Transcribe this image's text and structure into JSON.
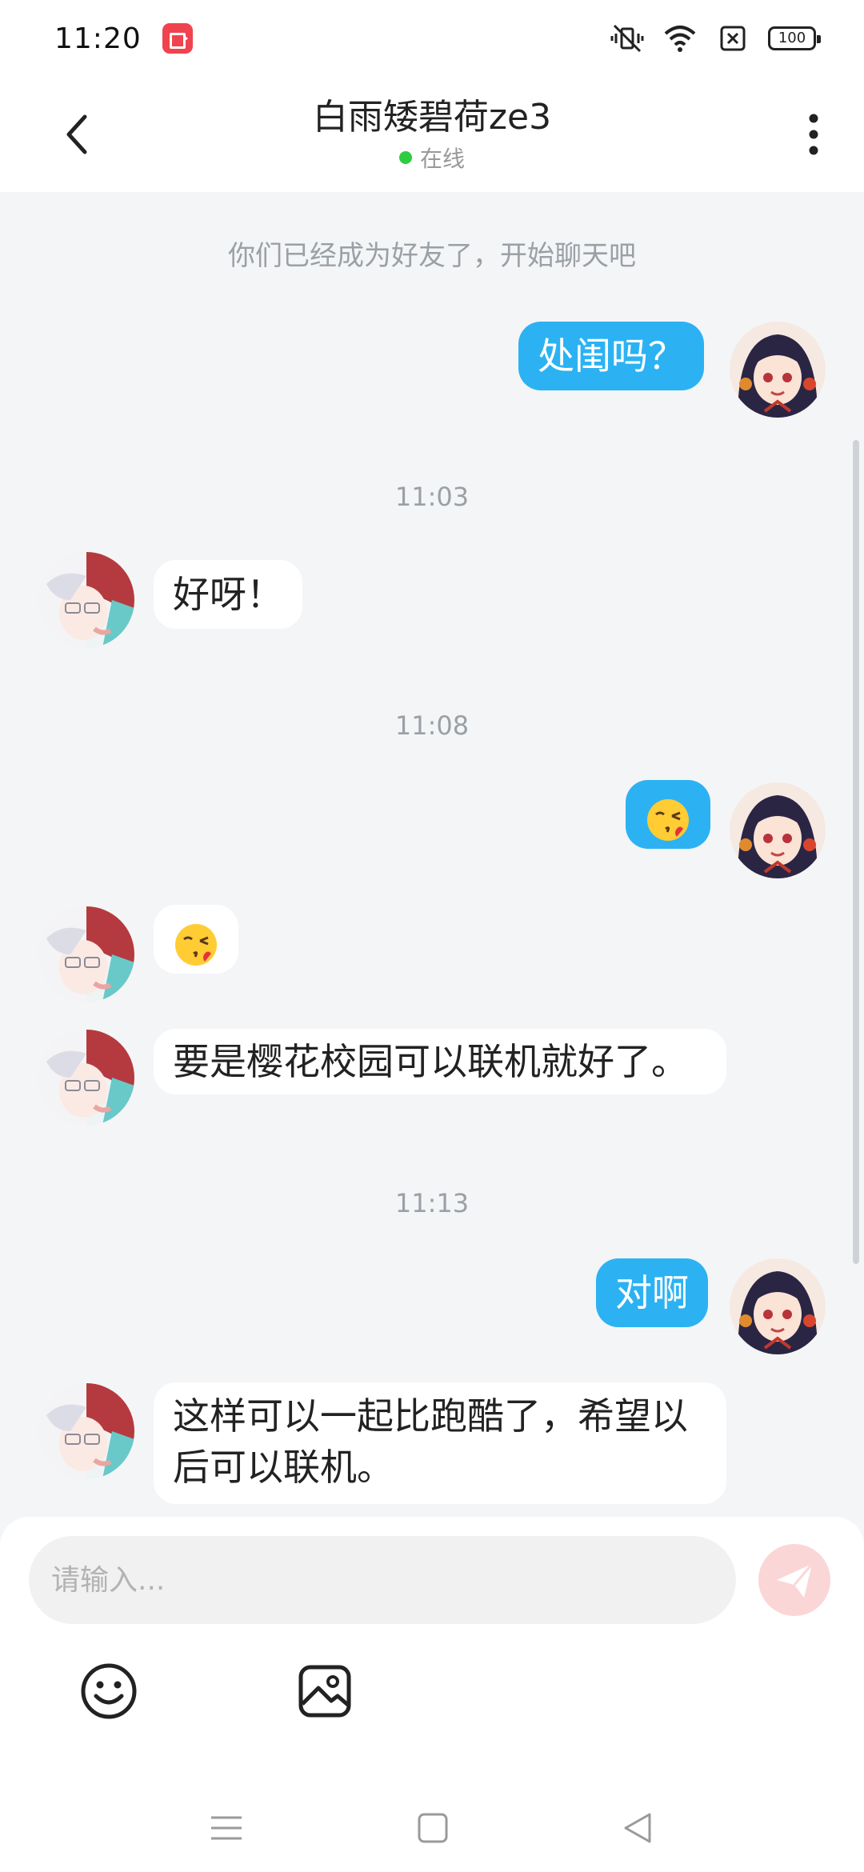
{
  "status_bar": {
    "time": "11:20",
    "battery": "100"
  },
  "header": {
    "title": "白雨矮碧荷ze3",
    "presence": "在线",
    "online_color": "#2ecc40"
  },
  "chat": {
    "system_notice": "你们已经成为好友了，开始聊天吧",
    "messages": [
      {
        "from": "me",
        "text": "处闺吗？"
      },
      {
        "timestamp": "11:03"
      },
      {
        "from": "them",
        "text": "好呀！"
      },
      {
        "timestamp": "11:08"
      },
      {
        "from": "me",
        "emoji": "kissing-face-emoji"
      },
      {
        "from": "them",
        "emoji": "kissing-face-emoji"
      },
      {
        "from": "them",
        "text": "要是樱花校园可以联机就好了。"
      },
      {
        "timestamp": "11:13"
      },
      {
        "from": "me",
        "text": "对啊"
      },
      {
        "from": "them",
        "text_line1": "这样可以一起比跑酷了，希望以",
        "text_line2": "后可以联机。"
      }
    ],
    "timestamps": [
      "11:03",
      "11:08",
      "11:13"
    ]
  },
  "composer": {
    "placeholder": "请输入...",
    "value": "",
    "send_color": "#fbd6d6"
  },
  "colors": {
    "outgoing_bubble": "#2cb2f3",
    "incoming_bubble": "#ffffff",
    "background": "#f4f5f7"
  },
  "icons": [
    "back-arrow-icon",
    "more-dots-icon",
    "emoji-icon",
    "image-icon",
    "send-icon",
    "nav-menu-icon",
    "nav-home-icon",
    "nav-back-icon"
  ]
}
